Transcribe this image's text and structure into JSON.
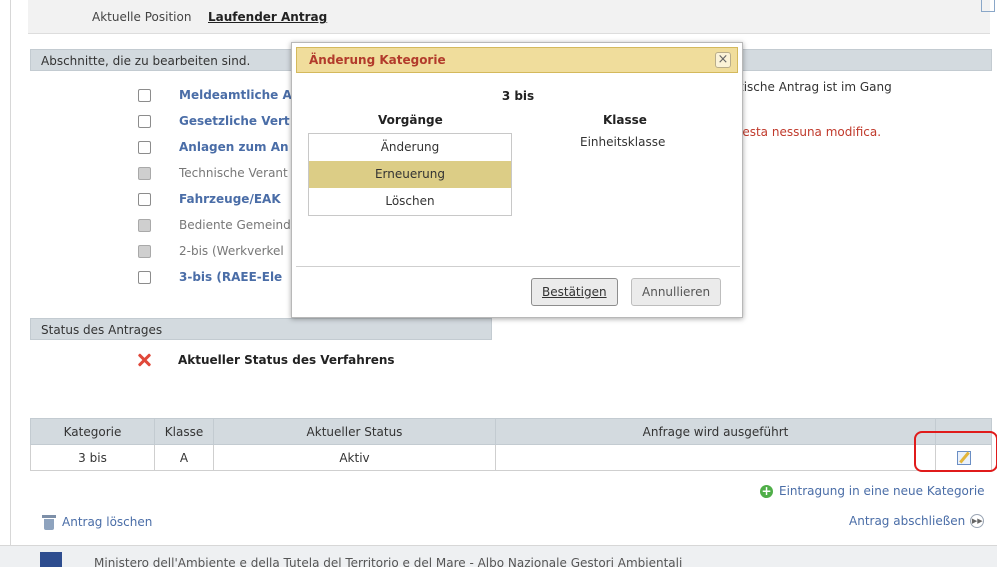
{
  "header": {
    "position_label": "Aktuelle Position",
    "position_value": "Laufender Antrag"
  },
  "sections": {
    "edit_title": "Abschnitte, die zu bearbeiten sind.",
    "status_title": "Status des Antrages"
  },
  "items": [
    {
      "label": "Meldeamtliche A",
      "style": "link"
    },
    {
      "label": "Gesetzliche Vert",
      "style": "link"
    },
    {
      "label": "Anlagen zum An",
      "style": "link"
    },
    {
      "label": "Technische Verant",
      "style": "plain"
    },
    {
      "label": "Fahrzeuge/EAK",
      "style": "link"
    },
    {
      "label": "Bediente Gemeind",
      "style": "plain"
    },
    {
      "label": "2-bis (Werkverkel",
      "style": "plain"
    },
    {
      "label": "3-bis (RAEE-Ele",
      "style": "link"
    }
  ],
  "notes": {
    "line1": "tische Antrag ist im Gang",
    "line2": "iesta nessuna modifica."
  },
  "status": {
    "title": "Aktueller Status des Verfahrens"
  },
  "table": {
    "headers": [
      "Kategorie",
      "Klasse",
      "Aktueller Status",
      "Anfrage wird ausgeführt",
      ""
    ],
    "rows": [
      {
        "kategorie": "3 bis",
        "klasse": "A",
        "status": "Aktiv",
        "anfrage": ""
      }
    ]
  },
  "actions": {
    "new_category": "Eintragung in eine neue Kategorie",
    "delete": "Antrag löschen",
    "close": "Antrag abschließen"
  },
  "footer": {
    "text": "Ministero dell'Ambiente e della Tutela del Territorio e del Mare - Albo Nazionale Gestori Ambientali"
  },
  "modal": {
    "title": "Änderung Kategorie",
    "close_glyph": "×",
    "subtitle": "3 bis",
    "col_ops": "Vorgänge",
    "col_class": "Klasse",
    "operations": [
      "Änderung",
      "Erneuerung",
      "Löschen"
    ],
    "selected_operation": "Erneuerung",
    "class_value": "Einheitsklasse",
    "confirm_label": "Bestätigen",
    "cancel_label": "Annullieren"
  },
  "colors": {
    "link": "#4a6da7",
    "header_bg": "#d3dadf",
    "modal_header_bg": "#f0dd9c",
    "selected_bg": "#dccd86",
    "error_red": "#c0392b",
    "highlight_red": "#e01b1b"
  }
}
